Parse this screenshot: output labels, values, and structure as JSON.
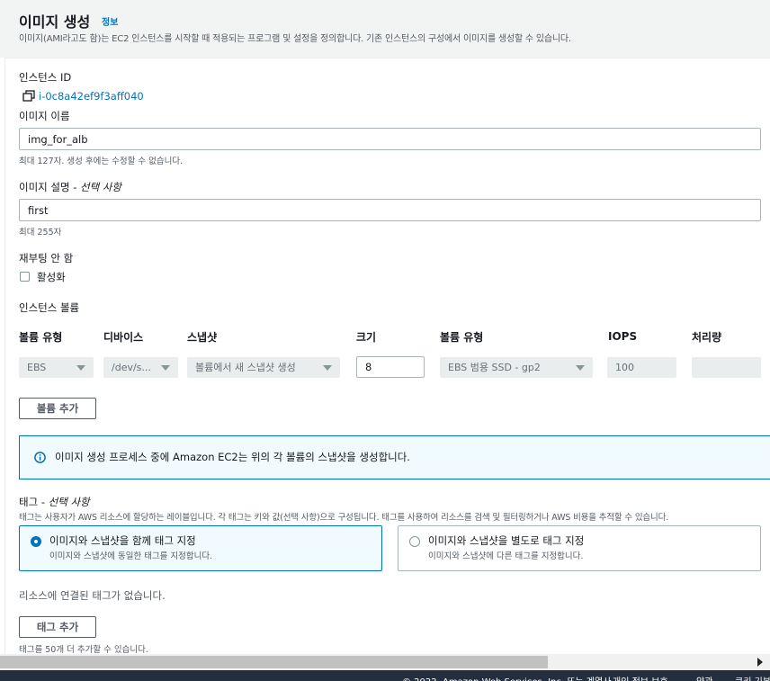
{
  "header": {
    "title": "이미지 생성",
    "info_link": "정보",
    "description": "이미지(AMI라고도 함)는 EC2 인스턴스를 시작할 때 적용되는 프로그램 및 설정을 정의합니다. 기존 인스턴스의 구성에서 이미지를 생성할 수 있습니다."
  },
  "instance": {
    "label": "인스턴스 ID",
    "id": "i-0c8a42ef9f3aff040"
  },
  "image_name": {
    "label": "이미지 이름",
    "value": "img_for_alb",
    "hint": "최대 127자. 생성 후에는 수정할 수 없습니다."
  },
  "image_description": {
    "label": "이미지 설명 - ",
    "optional": "선택 사항",
    "value": "first",
    "hint": "최대 255자"
  },
  "no_reboot": {
    "label": "재부팅 안 함",
    "checkbox_label": "활성화",
    "checked": false
  },
  "volumes": {
    "label": "인스턴스 볼륨",
    "columns": [
      "볼륨 유형",
      "디바이스",
      "스냅샷",
      "크기",
      "볼륨 유형",
      "IOPS",
      "처리량"
    ],
    "row": {
      "volume_type": "EBS",
      "device": "/dev/s...",
      "snapshot": "볼륨에서 새 스냅샷 생성",
      "size": "8",
      "ebs_type": "EBS 범용 SSD - gp2",
      "iops": "100",
      "throughput": ""
    },
    "add_button": "볼륨 추가"
  },
  "alert": {
    "text": "이미지 생성 프로세스 중에 Amazon EC2는 위의 각 볼륨의 스냅샷을 생성합니다."
  },
  "tags": {
    "label": "태그 - ",
    "optional": "선택 사항",
    "description": "태그는 사용자가 AWS 리소스에 할당하는 레이블입니다. 각 태그는 키와 값(선택 사항)으로 구성됩니다. 태그를 사용하여 리소스를 검색 및 필터링하거나 AWS 비용을 추적할 수 있습니다.",
    "options": [
      {
        "title": "이미지와 스냅샷을 함께 태그 지정",
        "description": "이미지와 스냅샷에 동일한 태그를 지정합니다.",
        "selected": true
      },
      {
        "title": "이미지와 스냅샷을 별도로 태그 지정",
        "description": "이미지와 스냅샷에 다른 태그를 지정합니다.",
        "selected": false
      }
    ],
    "empty_text": "리소스에 연결된 태그가 없습니다.",
    "add_button": "태그 추가",
    "limit_hint": "태그를 50개 더 추가할 수 있습니다."
  },
  "footer": {
    "copyright": "© 2022, Amazon Web Services, Inc. 또는 계열사.",
    "privacy": "개인 정보 보호",
    "terms": "약관",
    "cookie": "쿠키 기본"
  },
  "colors": {
    "accent": "#0073bb",
    "header_bg": "#f2f3f3",
    "alert_bg": "#f1faff",
    "footer_bg": "#232f3e"
  }
}
